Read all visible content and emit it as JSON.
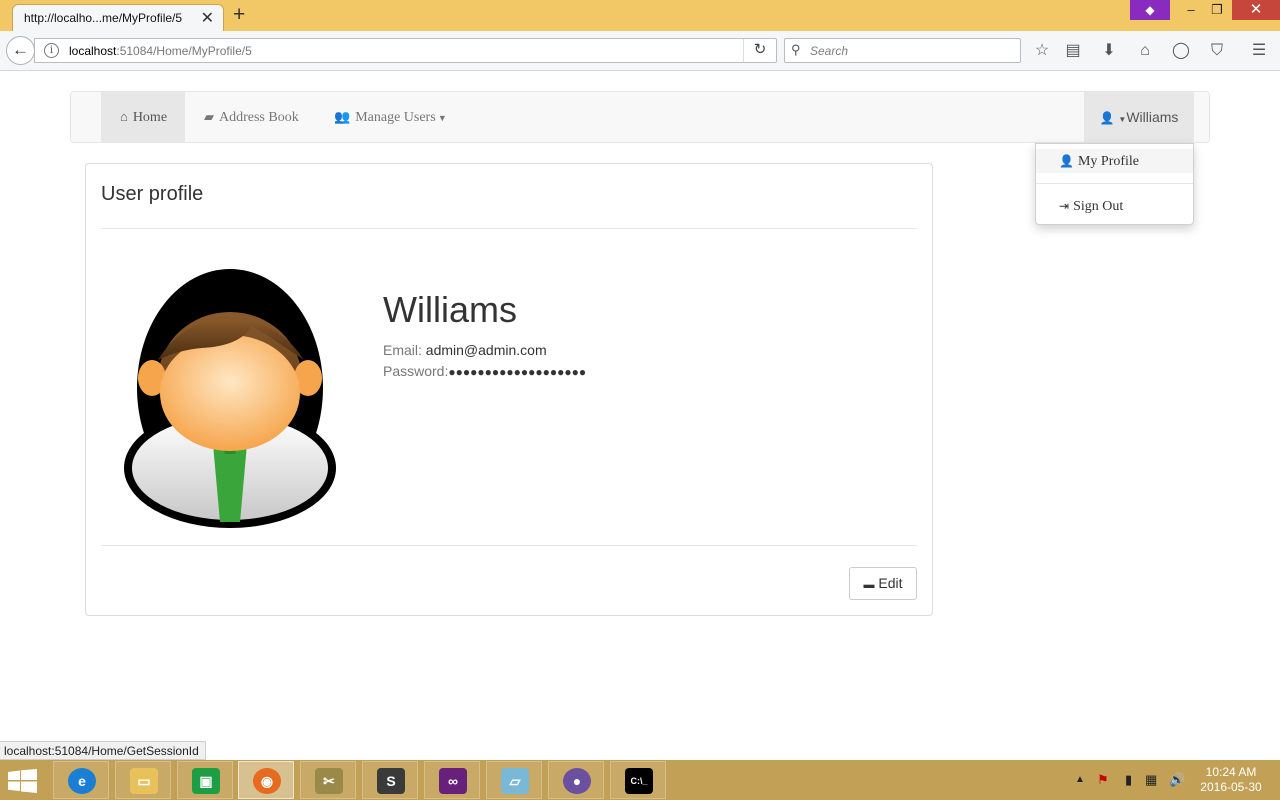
{
  "browser": {
    "tab_title": "http://localho...me/MyProfile/5",
    "url_host": "localhost",
    "url_rest": ":51084/Home/MyProfile/5",
    "search_placeholder": "Search",
    "status_url": "localhost:51084/Home/GetSessionId"
  },
  "nav": {
    "home": "Home",
    "address_book": "Address Book",
    "manage_users": "Manage Users",
    "user": "Williams"
  },
  "user_dropdown": {
    "my_profile": "My Profile",
    "sign_out": "Sign Out"
  },
  "profile": {
    "panel_title": "User profile",
    "name": "Williams",
    "email_label": "Email:",
    "email": "admin@admin.com",
    "password_label": "Password:",
    "password": "●●●●●●●●●●●●●●●●●●●",
    "edit_label": "Edit"
  },
  "taskbar": {
    "time": "10:24 AM",
    "date": "2016-05-30"
  }
}
